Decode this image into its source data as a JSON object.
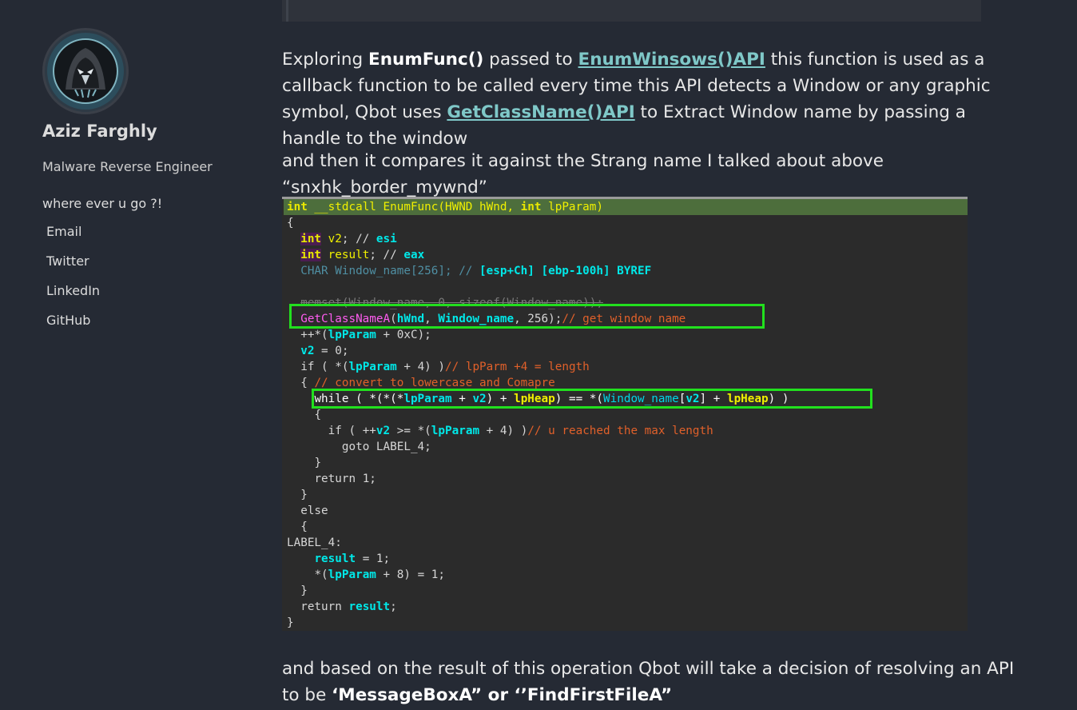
{
  "sidebar": {
    "author": "Aziz Farghly",
    "role": "Malware Reverse Engineer",
    "tagline": "where ever u go ?!",
    "links": [
      "Email",
      "Twitter",
      "LinkedIn",
      "GitHub"
    ]
  },
  "article": {
    "p1": {
      "t1": "Exploring ",
      "b1": "EnumFunc()",
      "t2": " passed to ",
      "link1": "EnumWinsows()API",
      "t3": " this function is used as a callback function to be called every time this API detects a Window or any graphic symbol, Qbot uses ",
      "link2": "GetClassName()API",
      "t4": " to Extract Window name by passing a handle to the window"
    },
    "p2": "and then it compares it against the Strang name I talked about above “snxhk_border_mywnd”",
    "p3": {
      "t1": "and based on the result of this operation Qbot will take a decision of resolving an API to be ",
      "b1": "‘MessageBoxA” or ‘’FindFirstFileA”"
    }
  },
  "code": {
    "l1_kw": "int",
    "l1_fn": " __stdcall EnumFunc(HWND hWnd, ",
    "l1_kw2": "int",
    "l1_end": " lpParam)",
    "l2": "{",
    "l3_kw": "int",
    "l3_v": "v2",
    "l3_c": "; // ",
    "l3_r": "esi",
    "l4_kw": "int",
    "l4_v": "result",
    "l4_c": "; // ",
    "l4_r": "eax",
    "l5_t": "CHAR Window_name[256]; // ",
    "l5_r": "[esp+Ch] [ebp-100h] BYREF",
    "l7": "memset(Window_name, 0, sizeof(Window_name));",
    "l8_f": "GetClassNameA",
    "l8_a": "hWnd",
    "l8_b": "Window_name",
    "l8_n": ", 256);",
    "l8_c": "// get window name",
    "l9_a": "++*(",
    "l9_b": "lpParam",
    "l9_c": " + 0xC);",
    "l10_a": "v2",
    "l10_b": " = 0;",
    "l11_a": "if ( *(",
    "l11_b": "lpParam",
    "l11_c": " + 4) )",
    "l11_d": "// lpParm +4 = length",
    "l12_a": "{ ",
    "l12_b": "// convert to lowercase and Comapre",
    "l13_a": "while ( *(*(*",
    "l13_b": "lpParam",
    "l13_c": " + ",
    "l13_d": "v2",
    "l13_e": ") + ",
    "l13_f": "lpHeap",
    "l13_g": ") == *(",
    "l13_h": "Window_name",
    "l13_i": "[",
    "l13_j": "v2",
    "l13_k": "] + ",
    "l13_l": "lpHeap",
    "l13_m": ") )",
    "l14": "{",
    "l15_a": "if ( ++",
    "l15_b": "v2",
    "l15_c": " >= *(",
    "l15_d": "lpParam",
    "l15_e": " + 4) )",
    "l15_f": "// u reached the max length",
    "l16": "goto LABEL_4;",
    "l17": "}",
    "l18": "return 1;",
    "l19": "}",
    "l20": "else",
    "l21": "{",
    "l22": "LABEL_4:",
    "l23_a": "result",
    "l23_b": " = 1;",
    "l24_a": "*(",
    "l24_b": "lpParam",
    "l24_c": " + 8) = 1;",
    "l25": "}",
    "l26_a": "return ",
    "l26_b": "result",
    "l26_c": ";",
    "l27": "}"
  }
}
